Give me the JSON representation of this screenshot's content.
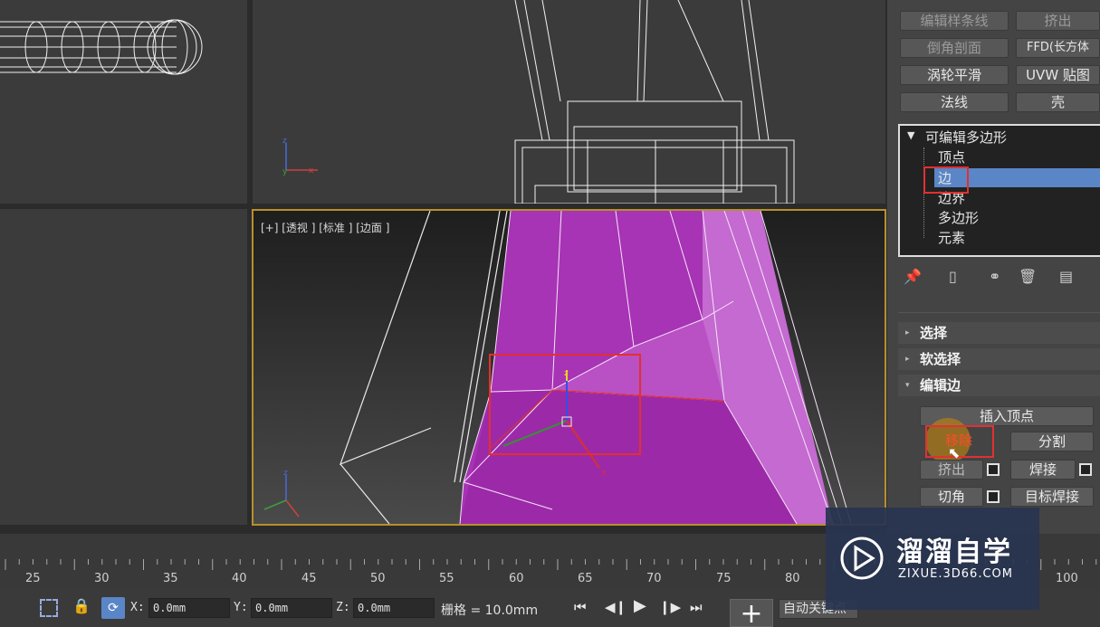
{
  "viewports": {
    "perspective_label": "[+] [透视 ] [标准 ] [边面 ]"
  },
  "modifier_buttons": [
    {
      "label": "编辑样条线",
      "enabled": false
    },
    {
      "label": "挤出",
      "enabled": false
    },
    {
      "label": "倒角剖面",
      "enabled": false
    },
    {
      "label": "FFD(长方体",
      "enabled": true
    },
    {
      "label": "涡轮平滑",
      "enabled": true
    },
    {
      "label": "UVW 贴图",
      "enabled": true
    },
    {
      "label": "法线",
      "enabled": true
    },
    {
      "label": "壳",
      "enabled": true
    }
  ],
  "modifier_stack": {
    "root": "可编辑多边形",
    "items": [
      "顶点",
      "边",
      "边界",
      "多边形",
      "元素"
    ],
    "selected": "边"
  },
  "rollouts": {
    "select": "选择",
    "soft_select": "软选择",
    "edit_edges": "编辑边"
  },
  "edit_edges": {
    "insert_vertex": "插入顶点",
    "remove": "移除",
    "split": "分割",
    "extrude": "挤出",
    "weld": "焊接",
    "chamfer": "切角",
    "target_weld": "目标焊接"
  },
  "timeline": {
    "ticks": [
      "25",
      "30",
      "35",
      "40",
      "45",
      "50",
      "55",
      "60",
      "65",
      "70",
      "75",
      "80",
      "100"
    ]
  },
  "statusbar": {
    "x_label": "X:",
    "x_value": "0.0mm",
    "y_label": "Y:",
    "y_value": "0.0mm",
    "z_label": "Z:",
    "z_value": "0.0mm",
    "grid": "栅格 = 10.0mm",
    "auto_key": "自动关键点"
  },
  "watermark": {
    "title": "溜溜自学",
    "url": "ZIXUE.3D66.COM"
  },
  "colors": {
    "accent_selected": "#5a86c8",
    "highlight_red": "#e23030",
    "object_magenta": "#b23ec0",
    "viewport_border": "#b8902a"
  }
}
